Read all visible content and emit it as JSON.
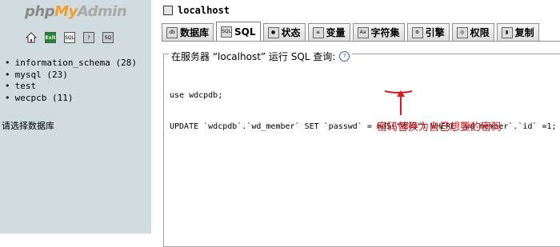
{
  "sidebar": {
    "logo": {
      "php": "php",
      "my": "My",
      "admin": "Admin"
    },
    "icons": [
      "home-icon",
      "exit-icon",
      "query-window-icon",
      "documentation-icon",
      "phpmyadmin-docs-icon"
    ],
    "databases": [
      {
        "label": "information_schema (28)"
      },
      {
        "label": "mysql (23)"
      },
      {
        "label": "test"
      },
      {
        "label": "wecpcb (11)"
      }
    ],
    "select_prompt": "请选择数据库"
  },
  "header": {
    "server": "localhost"
  },
  "tabs": [
    {
      "label": "数据库",
      "icon": "database-icon"
    },
    {
      "label": "SQL",
      "icon": "sql-icon",
      "active": true
    },
    {
      "label": "状态",
      "icon": "status-icon"
    },
    {
      "label": "变量",
      "icon": "variables-icon"
    },
    {
      "label": "字符集",
      "icon": "charset-icon"
    },
    {
      "label": "引擎",
      "icon": "engines-icon"
    },
    {
      "label": "权限",
      "icon": "privileges-icon"
    },
    {
      "label": "复制",
      "icon": "replication-icon"
    }
  ],
  "query_panel": {
    "legend": "在服务器 “localhost” 运行 SQL 查询:",
    "sql_line1": "use wdcpdb;",
    "sql_line2": "UPDATE `wdcpdb`.`wd_member` SET `passwd` = md5(\"密码\") WHERE `wd_member`.`id` =1;",
    "annotation": "密码替换为自己想要的密码"
  },
  "colors": {
    "sidebar_bg": "#d0dce0",
    "annotation": "#e0141a",
    "logo_my": "#f29e2c"
  }
}
